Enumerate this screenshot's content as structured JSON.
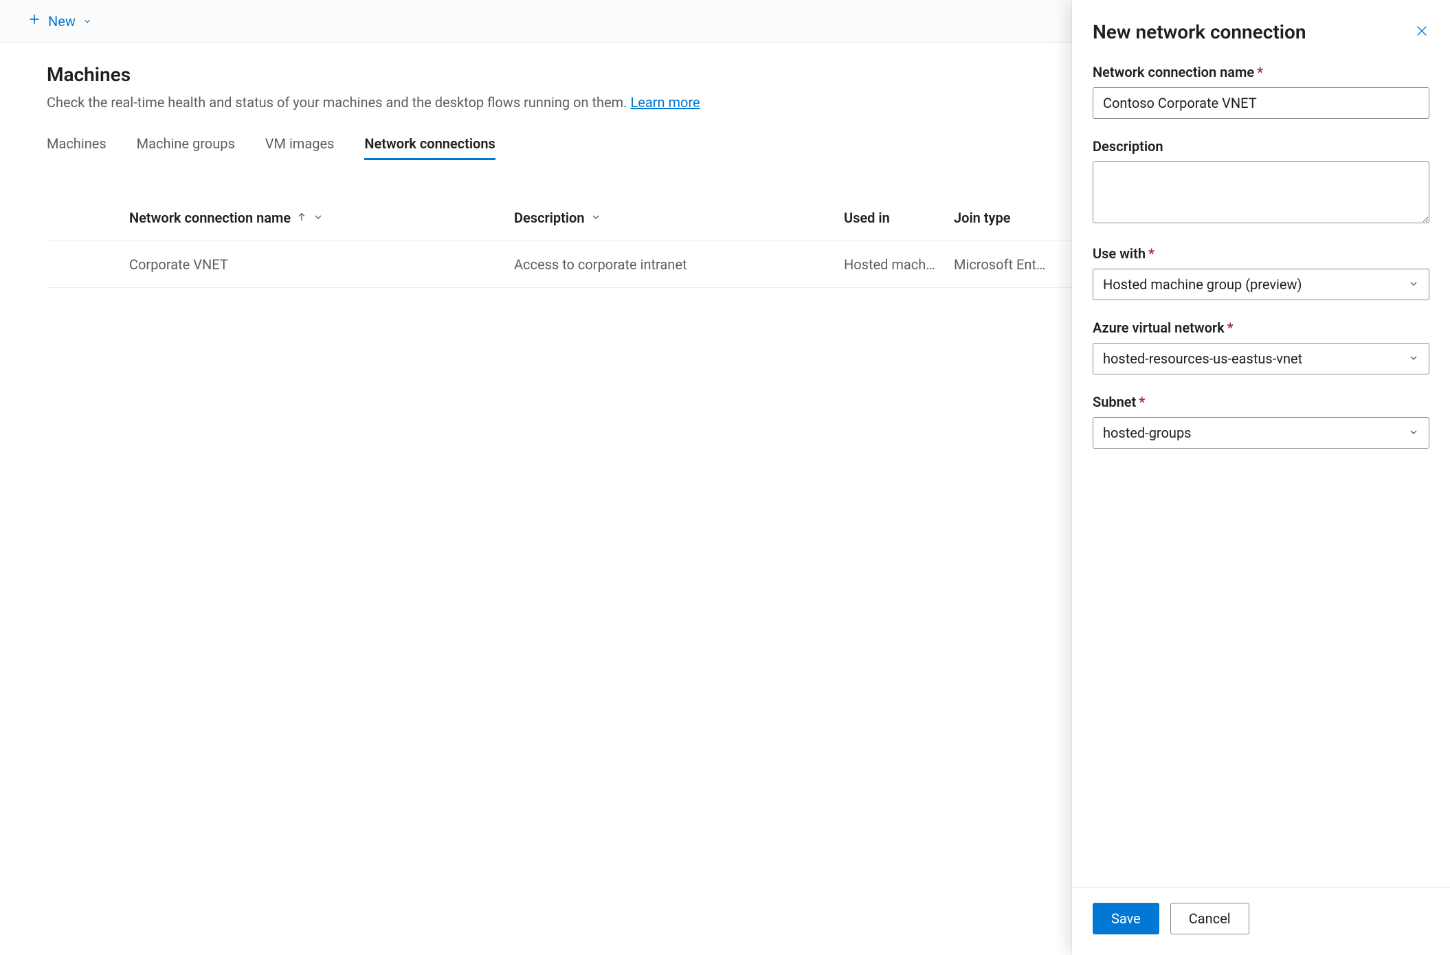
{
  "toolbar": {
    "new_label": "New"
  },
  "page": {
    "title": "Machines",
    "subtext": "Check the real-time health and status of your machines and the desktop flows running on them. ",
    "learn_more": "Learn more"
  },
  "tabs": [
    {
      "label": "Machines",
      "active": false
    },
    {
      "label": "Machine groups",
      "active": false
    },
    {
      "label": "VM images",
      "active": false
    },
    {
      "label": "Network connections",
      "active": true
    }
  ],
  "table": {
    "columns": {
      "name": "Network connection name",
      "description": "Description",
      "used_in": "Used in",
      "join_type": "Join type"
    },
    "rows": [
      {
        "name": "Corporate VNET",
        "description": "Access to corporate intranet",
        "used_in": "Hosted mach…",
        "join_type": "Microsoft Ent…"
      }
    ]
  },
  "panel": {
    "title": "New network connection",
    "fields": {
      "name_label": "Network connection name",
      "name_value": "Contoso Corporate VNET",
      "description_label": "Description",
      "description_value": "",
      "use_with_label": "Use with",
      "use_with_value": "Hosted machine group (preview)",
      "avn_label": "Azure virtual network",
      "avn_value": "hosted-resources-us-eastus-vnet",
      "subnet_label": "Subnet",
      "subnet_value": "hosted-groups"
    },
    "save_label": "Save",
    "cancel_label": "Cancel"
  }
}
